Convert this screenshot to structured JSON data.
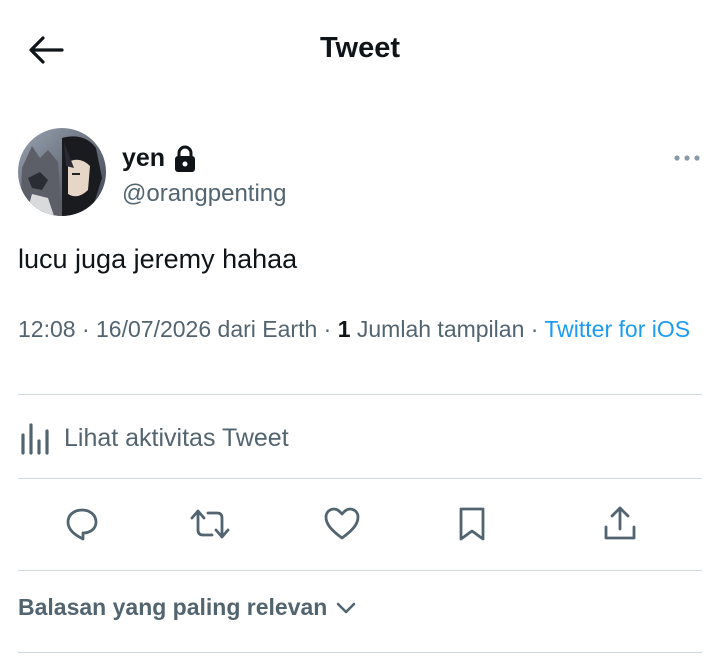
{
  "header": {
    "title": "Tweet",
    "back_icon": "arrow-left-icon"
  },
  "author": {
    "display_name": "yen",
    "handle": "@orangpenting",
    "protected_icon": "lock-icon",
    "avatar_desc": "avatar"
  },
  "tweet": {
    "text": "lucu juga jeremy hahaa"
  },
  "meta": {
    "time": "12:08",
    "date": "16/07/2026",
    "location": "dari Earth",
    "view_count": "1",
    "view_label": "Jumlah tampilan",
    "source": "Twitter for iOS",
    "separator": "·"
  },
  "activity": {
    "label": "Lihat aktivitas Tweet",
    "icon": "analytics-icon"
  },
  "actions": {
    "reply_icon": "reply-icon",
    "retweet_icon": "retweet-icon",
    "like_icon": "heart-icon",
    "bookmark_icon": "bookmark-icon",
    "share_icon": "share-icon"
  },
  "replies": {
    "sort_label": "Balasan yang paling relevan",
    "sort_icon": "chevron-down-icon"
  },
  "colors": {
    "text": "#0f1419",
    "secondary": "#536471",
    "link": "#1d9bf0",
    "divider": "#cfd9de"
  }
}
